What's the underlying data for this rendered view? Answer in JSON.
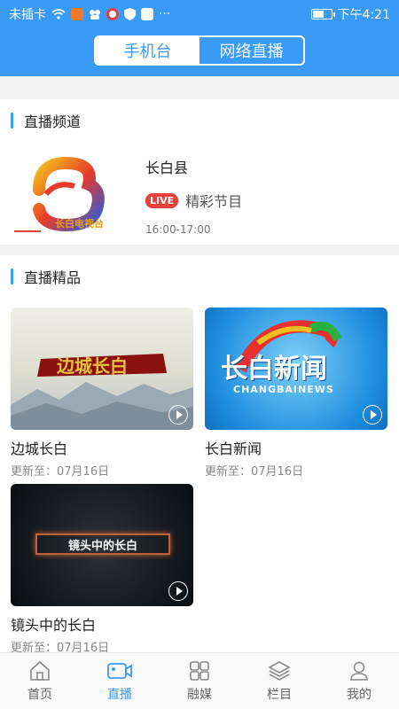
{
  "status_bar": {
    "carrier": "未插卡",
    "time": "下午4:21"
  },
  "header": {
    "segments": [
      {
        "label": "手机台",
        "active": true
      },
      {
        "label": "网络直播",
        "active": false
      }
    ]
  },
  "live_channels": {
    "title": "直播频道",
    "items": [
      {
        "name": "长白县",
        "logo_text": "长白电视台",
        "badge": "LIVE",
        "program": "精彩节目",
        "time": "16:00-17:00"
      }
    ]
  },
  "featured": {
    "title": "直播精品",
    "items": [
      {
        "title": "边城长白",
        "updated": "更新至：07月16日",
        "thumb_text": "边城长白"
      },
      {
        "title": "长白新闻",
        "updated": "更新至：07月16日",
        "thumb_text": "长白新闻",
        "thumb_subtext": "CHANGBAINEWS"
      },
      {
        "title": "镜头中的长白",
        "updated": "更新至：07月16日",
        "thumb_text": "镜头中的长白"
      }
    ]
  },
  "tabbar": {
    "tabs": [
      {
        "label": "首页",
        "icon": "home-icon",
        "active": false
      },
      {
        "label": "直播",
        "icon": "camera-icon",
        "active": true
      },
      {
        "label": "融媒",
        "icon": "grid-icon",
        "active": false
      },
      {
        "label": "栏目",
        "icon": "layers-icon",
        "active": false
      },
      {
        "label": "我的",
        "icon": "user-icon",
        "active": false
      }
    ]
  },
  "colors": {
    "primary": "#3a9af7",
    "live": "#e8413a"
  }
}
